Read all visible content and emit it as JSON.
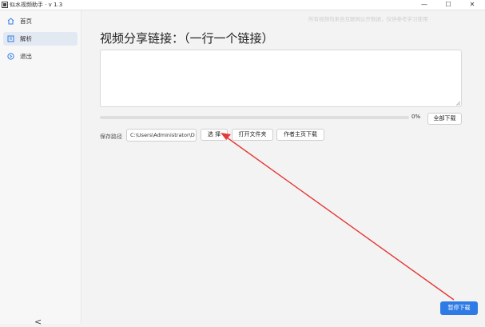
{
  "window": {
    "title": "似水视频助手 · v 1.3",
    "min_glyph": "—",
    "max_glyph": "☐",
    "close_glyph": "✕"
  },
  "sidebar": {
    "items": [
      {
        "label": "首页",
        "icon": "home-icon",
        "active": false
      },
      {
        "label": "解析",
        "icon": "parse-icon",
        "active": true
      },
      {
        "label": "退出",
        "icon": "exit-icon",
        "active": false
      }
    ],
    "collapse_glyph": "<"
  },
  "main": {
    "hint": "所有视频均来自互联网公开数据，仅供参考学习使用",
    "heading": "视频分享链接：（一行一个链接）",
    "link_input_value": "",
    "progress": {
      "value": 0,
      "label": "0%"
    },
    "download_all_label": "全部下载",
    "save_path_label": "保存路径",
    "save_path_value": "C:\\Users\\Administrator\\D",
    "choose_label": "选 择",
    "open_folder_label": "打开文件夹",
    "author_download_label": "作者主页下载",
    "pause_download_label": "暂停下载"
  },
  "colors": {
    "accent": "#2f7be5",
    "annotation_arrow": "#e53935"
  }
}
